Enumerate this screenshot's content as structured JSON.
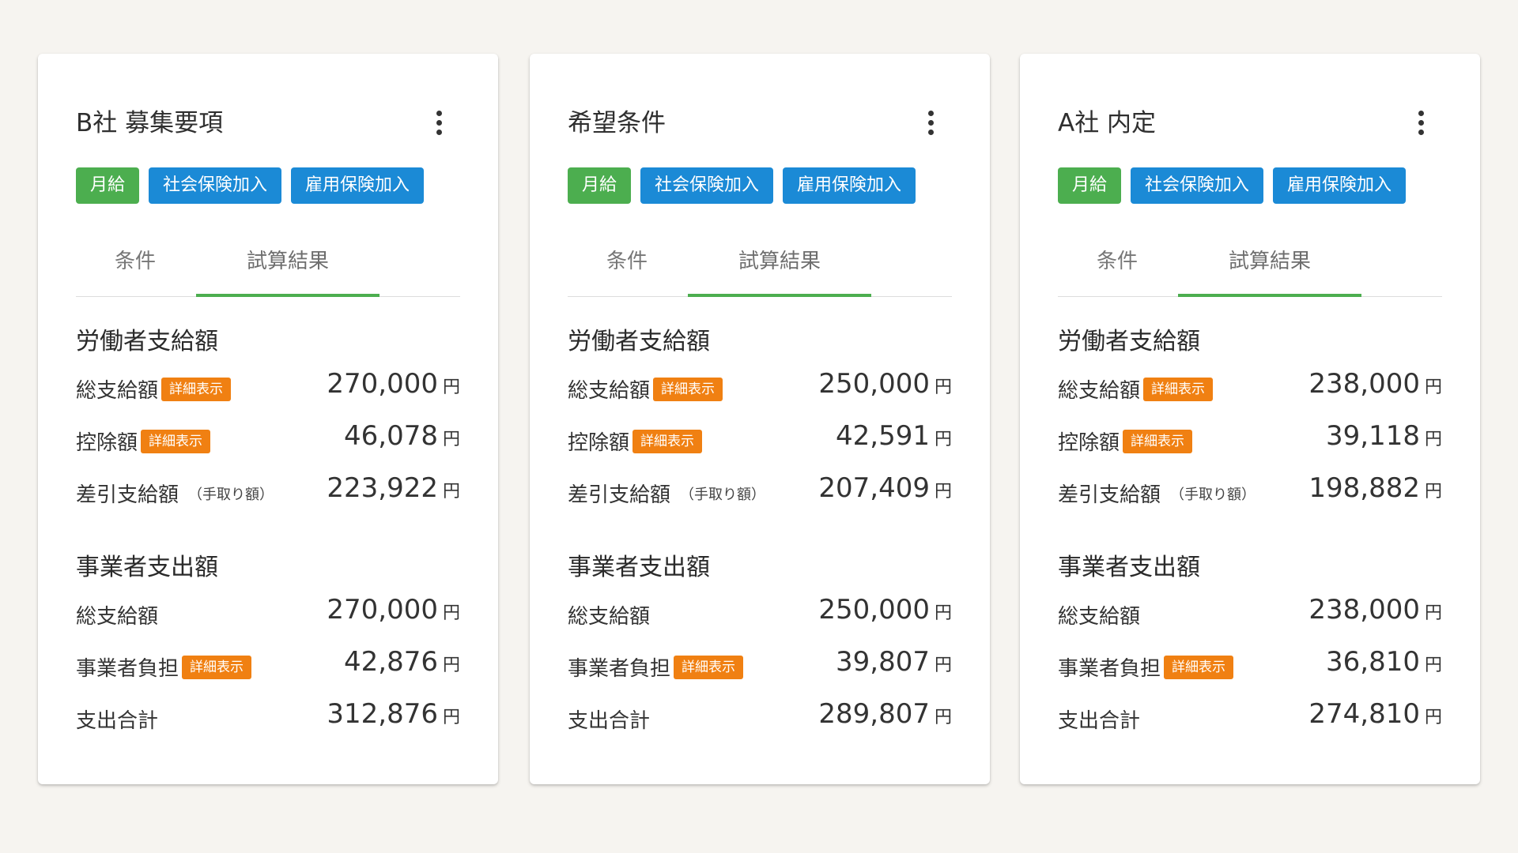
{
  "tabs": [
    "条件",
    "試算結果"
  ],
  "tags": [
    "月給",
    "社会保険加入",
    "雇用保険加入"
  ],
  "labels": {
    "worker_section": "労働者支給額",
    "employer_section": "事業者支出額",
    "gross": "総支給額",
    "deduction": "控除額",
    "net": "差引支給額",
    "net_note": "（手取り額）",
    "employer_burden": "事業者負担",
    "total": "支出合計",
    "detail": "詳細表示",
    "unit": "円"
  },
  "colors": {
    "green": "#4cae4f",
    "blue": "#1b8ad6",
    "orange": "#f08012"
  },
  "cards": [
    {
      "title": "B社 募集要項",
      "worker": {
        "gross": "270,000",
        "deduction": "46,078",
        "net": "223,922"
      },
      "employer": {
        "gross": "270,000",
        "burden": "42,876",
        "total": "312,876"
      }
    },
    {
      "title": "希望条件",
      "worker": {
        "gross": "250,000",
        "deduction": "42,591",
        "net": "207,409"
      },
      "employer": {
        "gross": "250,000",
        "burden": "39,807",
        "total": "289,807"
      }
    },
    {
      "title": "A社 内定",
      "worker": {
        "gross": "238,000",
        "deduction": "39,118",
        "net": "198,882"
      },
      "employer": {
        "gross": "238,000",
        "burden": "36,810",
        "total": "274,810"
      }
    }
  ]
}
